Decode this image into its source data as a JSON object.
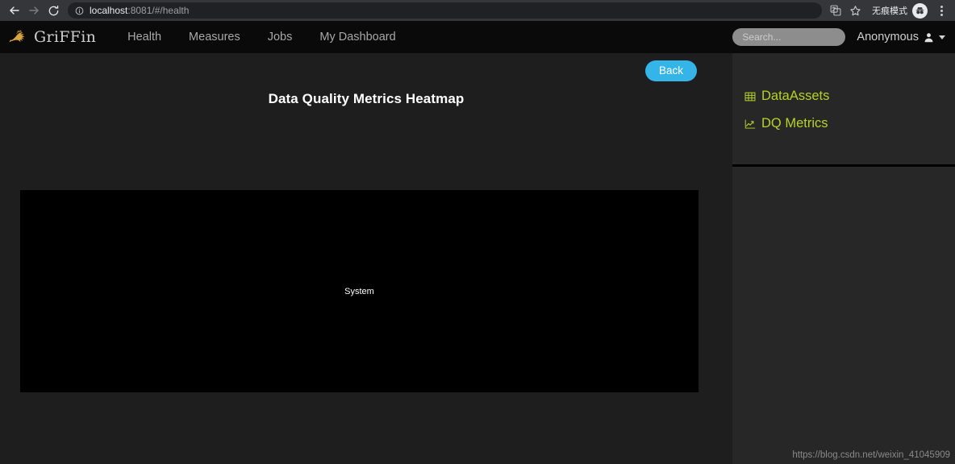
{
  "browser": {
    "back_label": "back-arrow",
    "forward_label": "forward-arrow",
    "reload_label": "reload",
    "url_scheme_host": "localhost",
    "url_rest": ":8081/#/health",
    "translate_icon": "translate-icon",
    "bookmark_icon": "star-icon",
    "incognito_label": "无痕模式",
    "menu_icon": "kebab-menu-icon"
  },
  "navbar": {
    "brand": "GriFFin",
    "links": [
      {
        "label": "Health"
      },
      {
        "label": "Measures"
      },
      {
        "label": "Jobs"
      },
      {
        "label": "My Dashboard"
      }
    ],
    "search_placeholder": "Search...",
    "search_value": "",
    "user_label": "Anonymous"
  },
  "main": {
    "back_label": "Back",
    "heatmap_title": "Data Quality Metrics Heatmap",
    "heatmap_label": "System",
    "heatmap_bg": "#000000"
  },
  "sidebar": {
    "items": [
      {
        "label": "DataAssets",
        "icon": "table-grid-icon"
      },
      {
        "label": "DQ Metrics",
        "icon": "line-chart-icon"
      }
    ],
    "accent_color": "#b5d325",
    "watermark": "https://blog.csdn.net/weixin_41045909"
  },
  "chart_data": {
    "type": "heatmap",
    "title": "Data Quality Metrics Heatmap",
    "categories": [
      "System"
    ],
    "values": [],
    "xlabel": "",
    "ylabel": "",
    "note": "Heatmap area renders empty (black) with a single centered label 'System'"
  }
}
